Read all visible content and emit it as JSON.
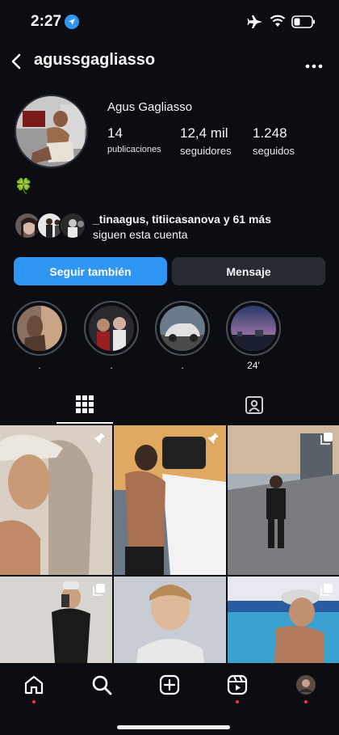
{
  "status_bar": {
    "time": "2:27"
  },
  "profile": {
    "username": "agussgagliasso",
    "full_name": "Agus Gagliasso",
    "bio_emoji": "🍀",
    "stats": {
      "posts": {
        "value": "14",
        "label": "publicaciones"
      },
      "followers": {
        "value": "12,4 mil",
        "label": "seguidores"
      },
      "following": {
        "value": "1.248",
        "label": "seguidos"
      }
    },
    "mutuals": {
      "names": "_tinaagus, titiicasanova",
      "suffix": " y 61 más",
      "line2": "siguen esta cuenta"
    }
  },
  "actions": {
    "follow_label": "Seguir también",
    "message_label": "Mensaje"
  },
  "highlights": [
    {
      "label": "."
    },
    {
      "label": "."
    },
    {
      "label": "."
    },
    {
      "label": "24'"
    }
  ],
  "colors": {
    "accent": "#2f96f3",
    "background": "#0b0d12",
    "button_dark": "#262a33",
    "notification": "#ff3040"
  }
}
